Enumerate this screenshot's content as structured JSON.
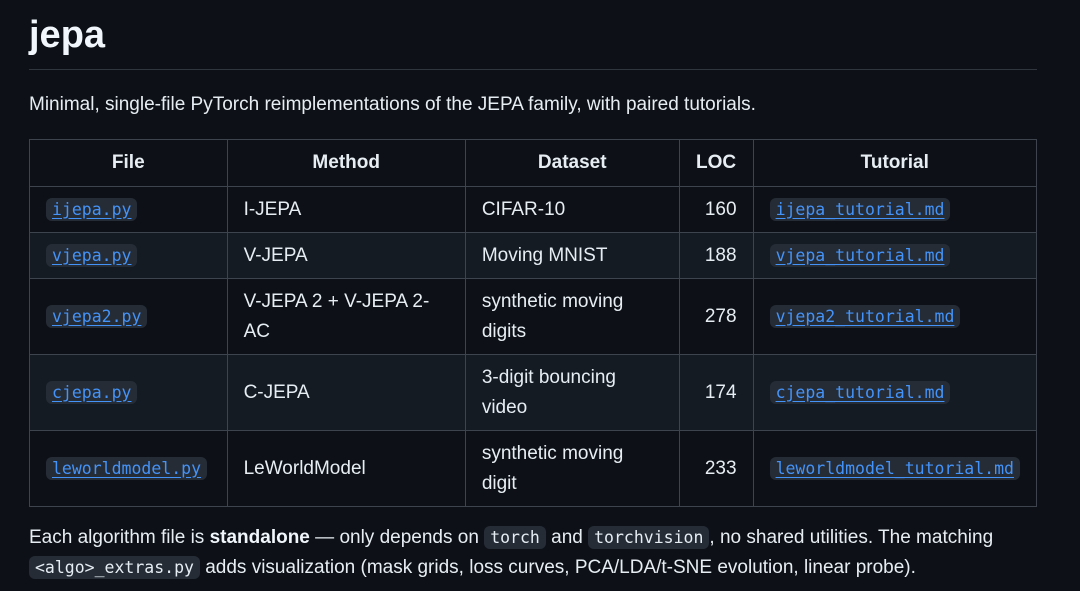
{
  "title": "jepa",
  "intro": "Minimal, single-file PyTorch reimplementations of the JEPA family, with paired tutorials.",
  "table": {
    "headers": [
      "File",
      "Method",
      "Dataset",
      "LOC",
      "Tutorial"
    ],
    "rows": [
      {
        "file": "ijepa.py",
        "method": "I-JEPA",
        "dataset": "CIFAR-10",
        "loc": "160",
        "tutorial": "ijepa_tutorial.md"
      },
      {
        "file": "vjepa.py",
        "method": "V-JEPA",
        "dataset": "Moving MNIST",
        "loc": "188",
        "tutorial": "vjepa_tutorial.md"
      },
      {
        "file": "vjepa2.py",
        "method": "V-JEPA 2 + V-JEPA 2-AC",
        "dataset": "synthetic moving digits",
        "loc": "278",
        "tutorial": "vjepa2_tutorial.md"
      },
      {
        "file": "cjepa.py",
        "method": "C-JEPA",
        "dataset": "3-digit bouncing video",
        "loc": "174",
        "tutorial": "cjepa_tutorial.md"
      },
      {
        "file": "leworldmodel.py",
        "method": "LeWorldModel",
        "dataset": "synthetic moving digit",
        "loc": "233",
        "tutorial": "leworldmodel_tutorial.md"
      }
    ]
  },
  "outro": {
    "part1": "Each algorithm file is ",
    "bold": "standalone",
    "part2": " — only depends on ",
    "code1": "torch",
    "part3": " and ",
    "code2": "torchvision",
    "part4": ", no shared utilities. The matching ",
    "code3": "<algo>_extras.py",
    "part5": " adds visualization (mask grids, loss curves, PCA/LDA/t-SNE evolution, linear probe)."
  },
  "colors": {
    "background": "#0d1117",
    "link": "#4493f8",
    "border": "#3d444d",
    "stripe": "#151b23"
  }
}
